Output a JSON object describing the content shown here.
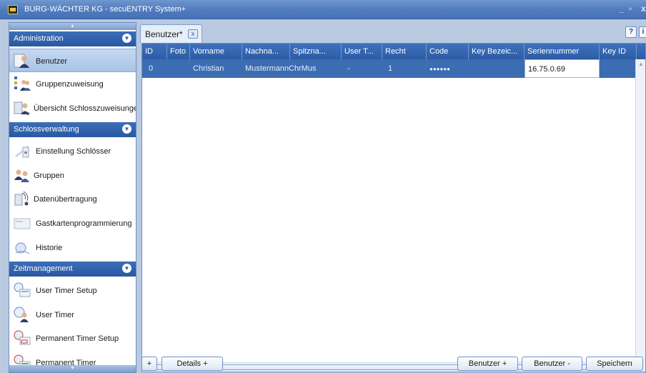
{
  "window": {
    "title": "BURG-WÄCHTER KG - secuENTRY System+"
  },
  "sidebar": {
    "sections": [
      {
        "label": "Administration",
        "items": [
          {
            "label": "Benutzer",
            "icon": "user-icon",
            "active": true
          },
          {
            "label": "Gruppenzuweisung",
            "icon": "group-assign-icon"
          },
          {
            "label": "Übersicht Schlosszuweisunge",
            "icon": "lock-overview-icon"
          }
        ]
      },
      {
        "label": "Schlossverwaltung",
        "items": [
          {
            "label": "Einstellung Schlösser",
            "icon": "lock-settings-icon"
          },
          {
            "label": "Gruppen",
            "icon": "groups-icon"
          },
          {
            "label": "Datenübertragung",
            "icon": "data-transfer-icon"
          },
          {
            "label": "Gastkartenprogrammierung",
            "icon": "guest-card-icon"
          },
          {
            "label": "Historie",
            "icon": "history-icon"
          }
        ]
      },
      {
        "label": "Zeitmanagement",
        "items": [
          {
            "label": "User Timer Setup",
            "icon": "timer-setup-icon"
          },
          {
            "label": "User Timer",
            "icon": "timer-icon"
          },
          {
            "label": "Permanent Timer Setup",
            "icon": "permanent-timer-setup-icon"
          },
          {
            "label": "Permanent Timer",
            "icon": "permanent-timer-icon"
          }
        ]
      }
    ]
  },
  "tabs": [
    {
      "label": "Benutzer*",
      "close": "x"
    }
  ],
  "help": {
    "label": "?",
    "info": "i"
  },
  "grid": {
    "columns": [
      "ID",
      "Foto",
      "Vorname",
      "Nachna...",
      "Spitzna...",
      "User T...",
      "Recht",
      "Code",
      "Key Bezeic...",
      "Seriennummer",
      "Key ID"
    ],
    "rows": [
      [
        "0",
        "",
        "Christian",
        "Mustermann",
        "ChrMus",
        "-",
        "1",
        "●●●●●●",
        "",
        "16.75.0.69",
        ""
      ]
    ]
  },
  "footer": {
    "plus": "+",
    "details": "Details +",
    "add_user": "Benutzer +",
    "remove_user": "Benutzer -",
    "save": "Speichern"
  }
}
